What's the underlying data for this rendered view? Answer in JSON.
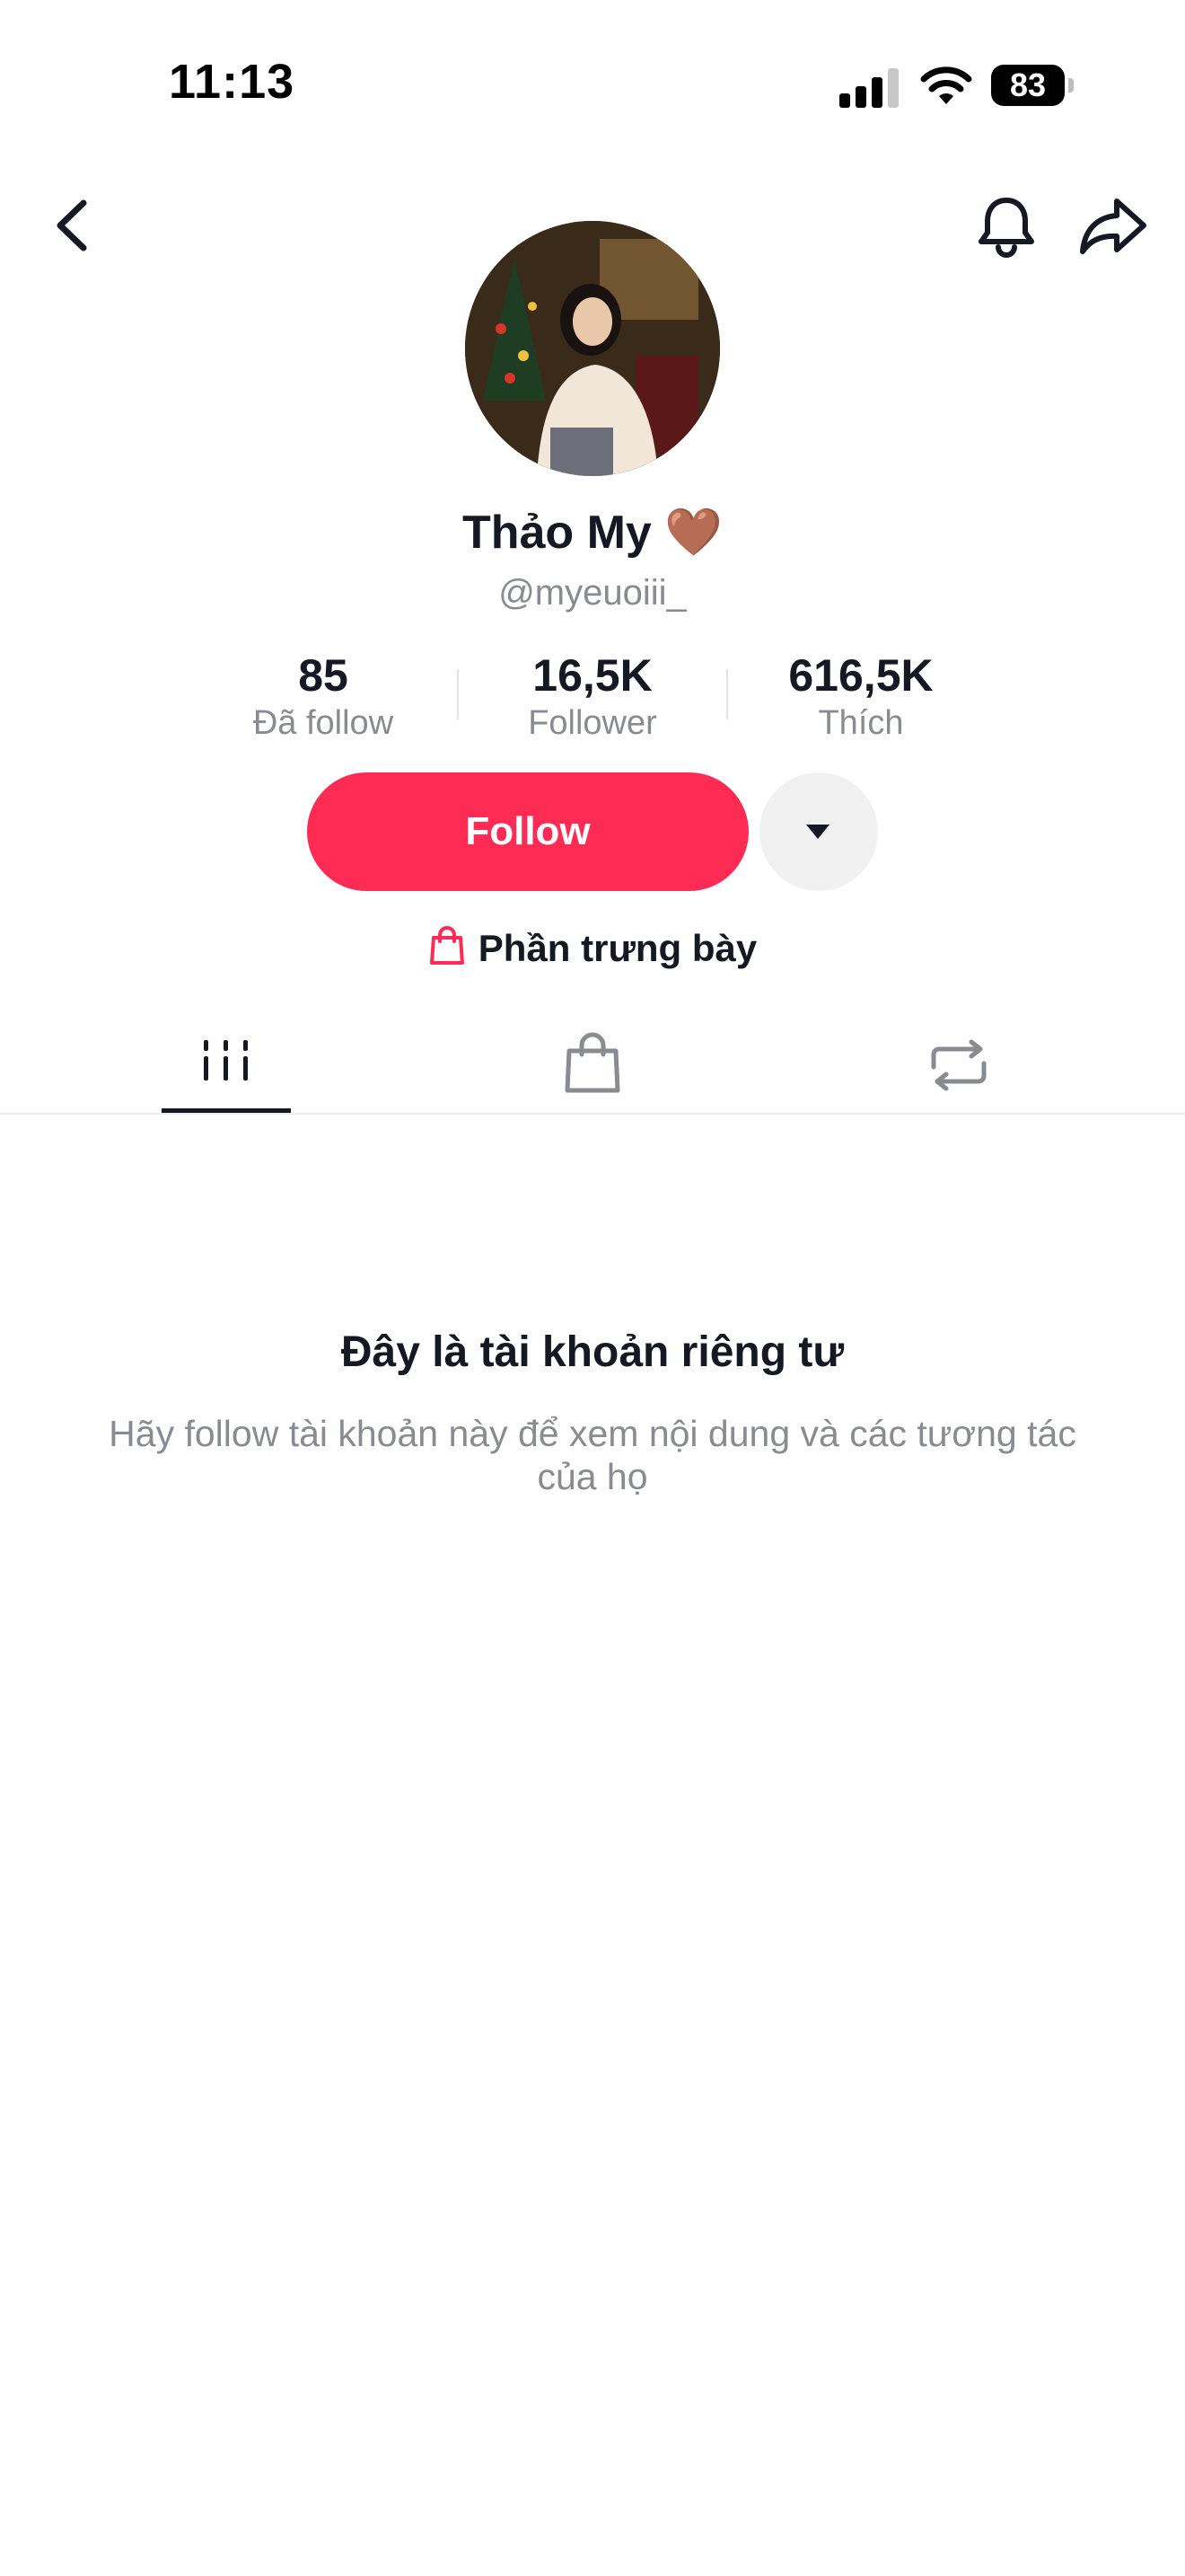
{
  "status_bar": {
    "time": "11:13",
    "battery": "83"
  },
  "profile": {
    "name": "Thảo My 🤎",
    "handle": "@myeuoiii_",
    "stats": [
      {
        "value": "85",
        "label": "Đã follow"
      },
      {
        "value": "16,5K",
        "label": "Follower"
      },
      {
        "value": "616,5K",
        "label": "Thích"
      }
    ]
  },
  "actions": {
    "follow_label": "Follow"
  },
  "showcase": {
    "label": "Phần trưng bày"
  },
  "tabs": [
    {
      "icon": "grid-icon",
      "active": true
    },
    {
      "icon": "shopping-bag-icon",
      "active": false
    },
    {
      "icon": "repost-icon",
      "active": false
    }
  ],
  "private": {
    "title": "Đây là tài khoản riêng tư",
    "subtitle": "Hãy follow tài khoản này để xem nội dung và các tương tác của họ"
  },
  "colors": {
    "accent": "#fe2c55",
    "text": "#161823",
    "muted": "#8a8b91"
  }
}
